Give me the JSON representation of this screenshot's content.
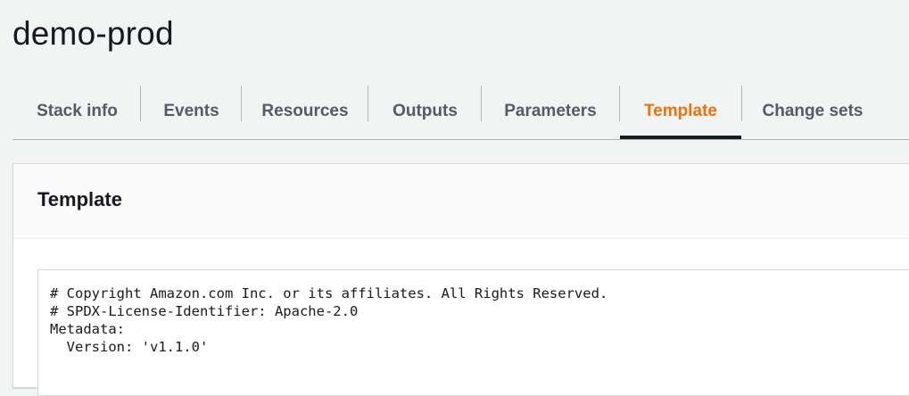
{
  "page": {
    "title": "demo-prod"
  },
  "tabs": [
    {
      "label": "Stack info",
      "active": false
    },
    {
      "label": "Events",
      "active": false
    },
    {
      "label": "Resources",
      "active": false
    },
    {
      "label": "Outputs",
      "active": false
    },
    {
      "label": "Parameters",
      "active": false
    },
    {
      "label": "Template",
      "active": true
    },
    {
      "label": "Change sets",
      "active": false
    }
  ],
  "template_panel": {
    "title": "Template",
    "code_lines": [
      "# Copyright Amazon.com Inc. or its affiliates. All Rights Reserved.",
      "# SPDX-License-Identifier: Apache-2.0",
      "Metadata:",
      "  Version: 'v1.1.0'"
    ]
  },
  "colors": {
    "background": "#f2f3f3",
    "active_tab_text": "#ec7211",
    "active_tab_underline": "#16191f",
    "tab_text": "#545b64",
    "divider": "#aab7b8",
    "panel": "#ffffff"
  }
}
